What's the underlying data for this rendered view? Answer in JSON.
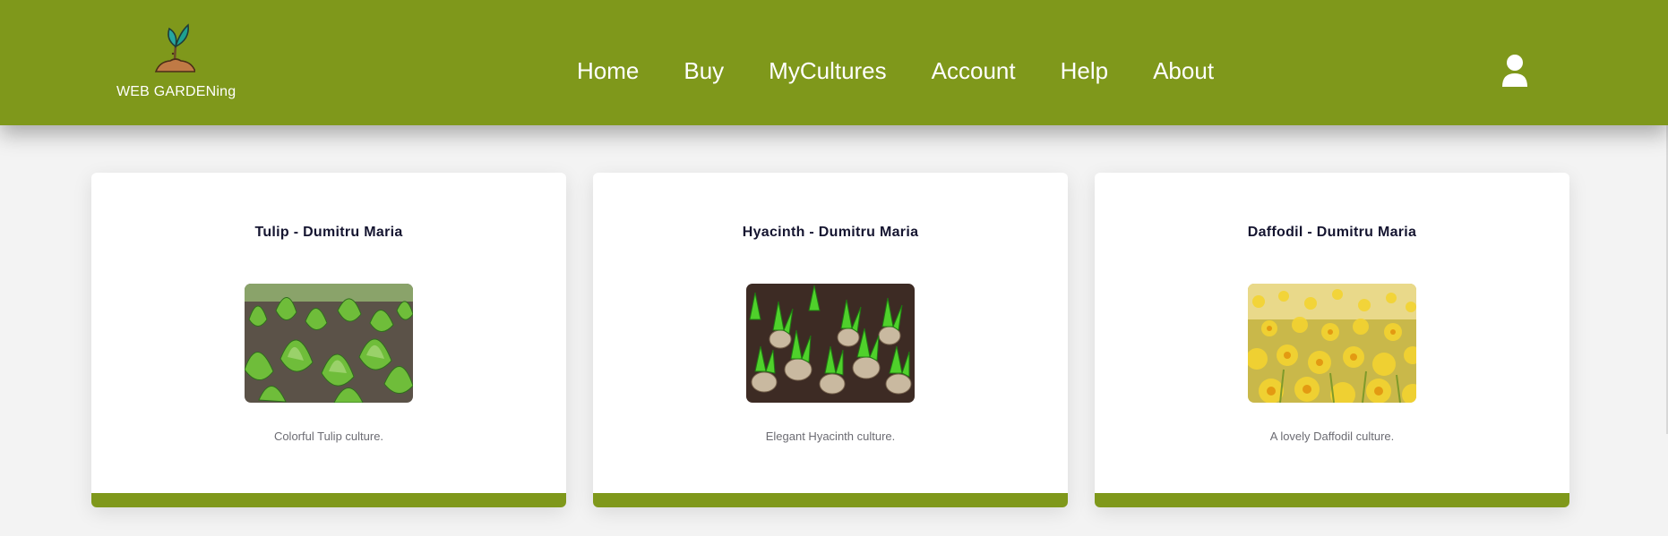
{
  "brand": {
    "name": "WEB GARDENing",
    "logo_icon": "sprout-in-soil-icon"
  },
  "nav": {
    "items": [
      {
        "label": "Home"
      },
      {
        "label": "Buy"
      },
      {
        "label": "MyCultures"
      },
      {
        "label": "Account"
      },
      {
        "label": "Help"
      },
      {
        "label": "About"
      }
    ]
  },
  "user_icon": "user-icon",
  "colors": {
    "accent": "#7f981b",
    "page_background": "#f3f3f3",
    "card_background": "#ffffff",
    "title_text": "#151530",
    "description_text": "#6c6c73"
  },
  "cultures": [
    {
      "title": "Tulip - Dumitru Maria",
      "image": "tulip-field-photo",
      "description": "Colorful Tulip culture."
    },
    {
      "title": "Hyacinth - Dumitru Maria",
      "image": "hyacinth-bulbs-photo",
      "description": "Elegant Hyacinth culture."
    },
    {
      "title": "Daffodil - Dumitru Maria",
      "image": "daffodil-field-photo",
      "description": "A lovely Daffodil culture."
    }
  ]
}
